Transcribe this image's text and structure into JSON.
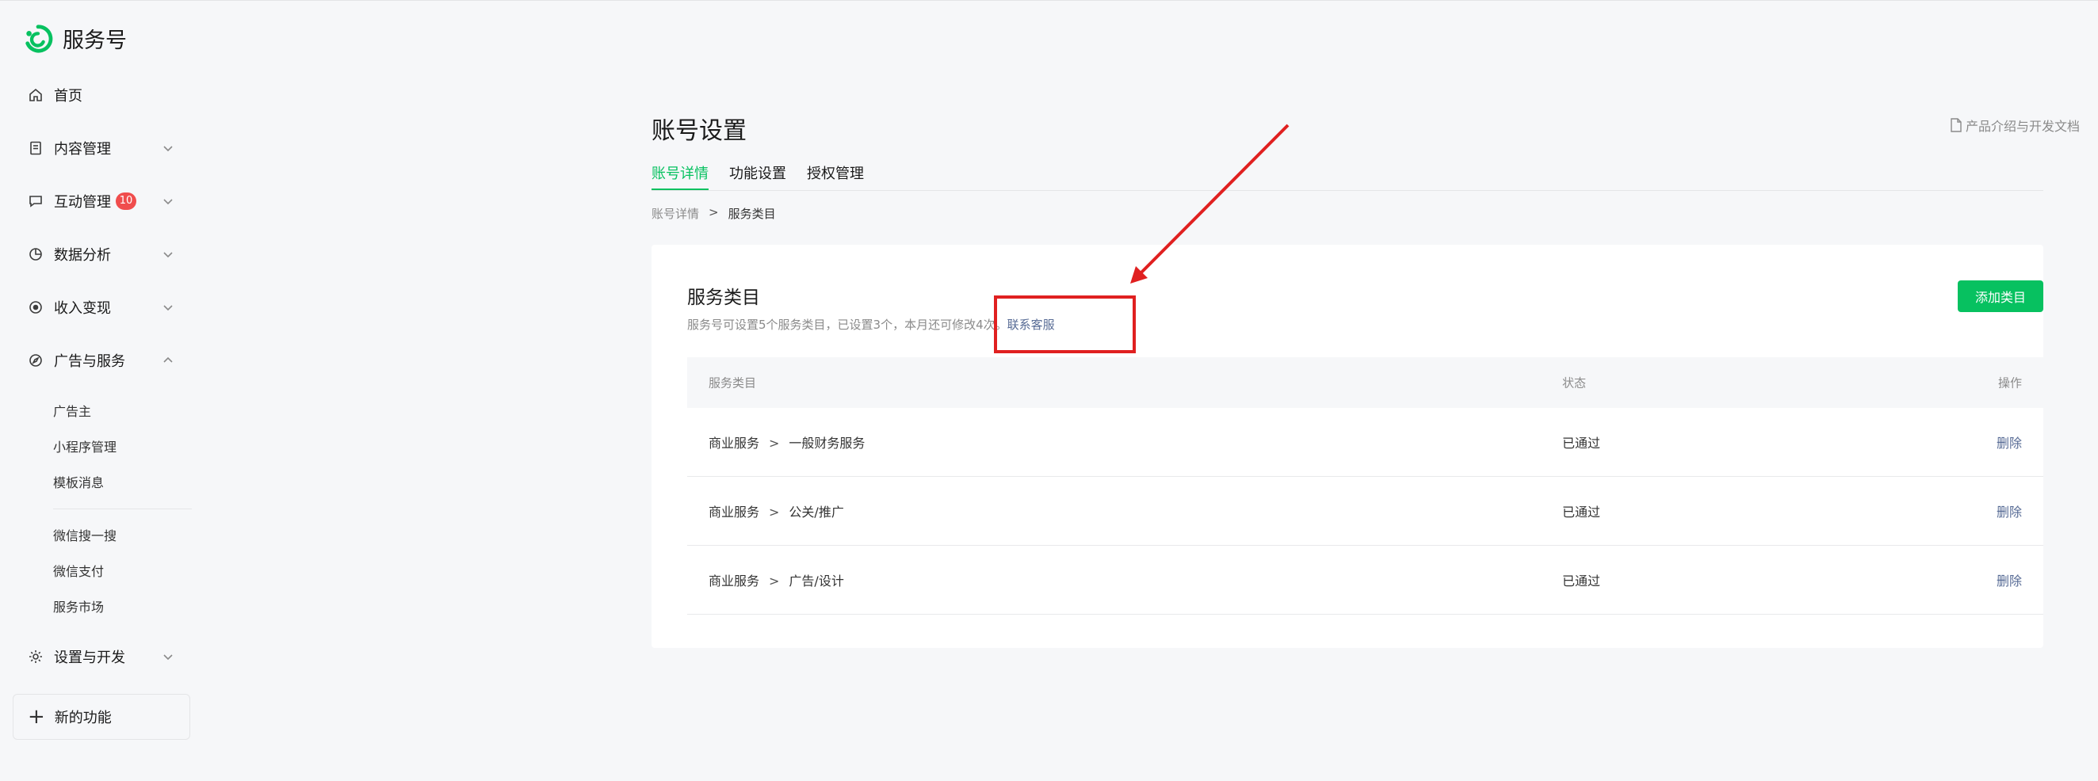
{
  "brand": {
    "name": "服务号"
  },
  "sidebar": {
    "items": [
      {
        "label": "首页"
      },
      {
        "label": "内容管理"
      },
      {
        "label": "互动管理",
        "badge": "10"
      },
      {
        "label": "数据分析"
      },
      {
        "label": "收入变现"
      },
      {
        "label": "广告与服务"
      },
      {
        "label": "设置与开发"
      }
    ],
    "sub_items": [
      "广告主",
      "小程序管理",
      "模板消息",
      "微信搜一搜",
      "微信支付",
      "服务市场"
    ],
    "new_feature": "新的功能"
  },
  "page": {
    "title": "账号设置",
    "doc_link": "产品介绍与开发文档",
    "tabs": [
      {
        "label": "账号详情",
        "active": true
      },
      {
        "label": "功能设置"
      },
      {
        "label": "授权管理"
      }
    ],
    "breadcrumb": {
      "parent": "账号详情",
      "separator": ">",
      "current": "服务类目"
    }
  },
  "card": {
    "title": "服务类目",
    "description": "服务号可设置5个服务类目，已设置3个，本月还可修改4次。",
    "contact_link": "联系客服",
    "add_button": "添加类目"
  },
  "table": {
    "headers": [
      "服务类目",
      "状态",
      "操作"
    ],
    "separator": ">",
    "rows": [
      {
        "parent": "商业服务",
        "child": "一般财务服务",
        "status": "已通过",
        "action": "删除"
      },
      {
        "parent": "商业服务",
        "child": "公关/推广",
        "status": "已通过",
        "action": "删除"
      },
      {
        "parent": "商业服务",
        "child": "广告/设计",
        "status": "已通过",
        "action": "删除"
      }
    ]
  },
  "colors": {
    "accent": "#07c160",
    "link": "#576b95",
    "badge": "#f04d4d",
    "annotation": "#e02020"
  }
}
